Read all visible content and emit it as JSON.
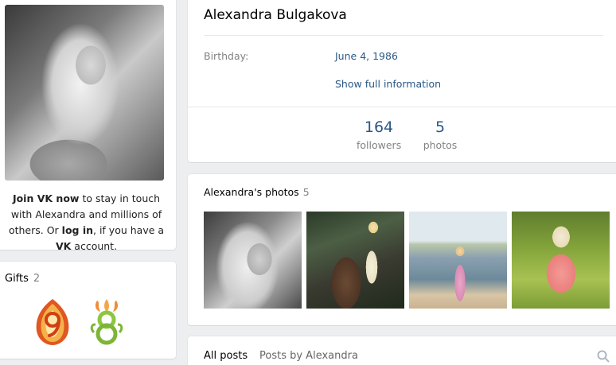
{
  "profile": {
    "name": "Alexandra Bulgakova",
    "join_bold": "Join VK now",
    "join_rest1": " to stay in touch with Alexandra and millions of others. Or ",
    "login_bold": "log in",
    "join_rest2": ", if you have a ",
    "vk_bold": "VK",
    "join_rest3": " account."
  },
  "gifts": {
    "title": "Gifts",
    "count": "2",
    "icons": [
      "gift-9-icon",
      "gift-8-icon"
    ]
  },
  "info": {
    "birthday_label": "Birthday:",
    "birthday_value": "June 4, 1986",
    "show_full": "Show full information"
  },
  "counters": [
    {
      "value": "164",
      "label": "followers"
    },
    {
      "value": "5",
      "label": "photos"
    }
  ],
  "photos": {
    "title": "Alexandra's photos",
    "count": "5"
  },
  "posts": {
    "tab_all": "All posts",
    "tab_by": "Posts by Alexandra"
  },
  "colors": {
    "link": "#2a5885",
    "muted": "#828282",
    "background": "#edeef0"
  }
}
